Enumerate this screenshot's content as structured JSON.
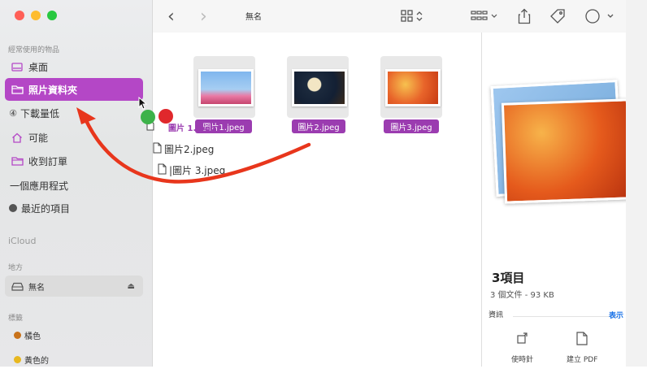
{
  "sidebar": {
    "section_favorites": "經常使用的物品",
    "items": [
      {
        "label": "桌面",
        "icon": "desktop-icon"
      },
      {
        "label": "照片資料夾",
        "icon": "folder-icon"
      },
      {
        "label": "下載量低",
        "icon": "download-icon",
        "prefix": "④"
      },
      {
        "label": "可能",
        "icon": "home-icon"
      },
      {
        "label": "收到訂單",
        "icon": "folder-icon"
      },
      {
        "label": "一個應用程式"
      },
      {
        "label": "最近的項目",
        "icon": "clock-icon"
      }
    ],
    "section_icloud": "iCloud",
    "section_locations": "地方",
    "volume": {
      "label": "無名",
      "icon": "drive-icon"
    },
    "section_tags": "標籤",
    "tags": [
      {
        "label": "橘色",
        "color": "#c8721a"
      },
      {
        "label": "黃色的",
        "color": "#e8b820"
      }
    ]
  },
  "toolbar": {
    "back": "‹",
    "forward": "›",
    "title": "無名"
  },
  "files": {
    "drag_labels": [
      "圖片1.jpeg",
      "圖片2.jpeg",
      "圖片3.jpeg"
    ],
    "overlay_label": "圖片 1.jpeg",
    "rows": [
      "圖片2.jpeg",
      "|圖片 3.jpeg"
    ]
  },
  "preview": {
    "title": "3項目",
    "subtitle": "3 個文件 - 93 KB",
    "info_label": "資訊",
    "more_label": "表示",
    "actions": [
      "使時針",
      "建立 PDF"
    ]
  },
  "colors": {
    "accent": "#b447c6",
    "selection": "#9b3cb0",
    "arrow": "#e8361c"
  }
}
